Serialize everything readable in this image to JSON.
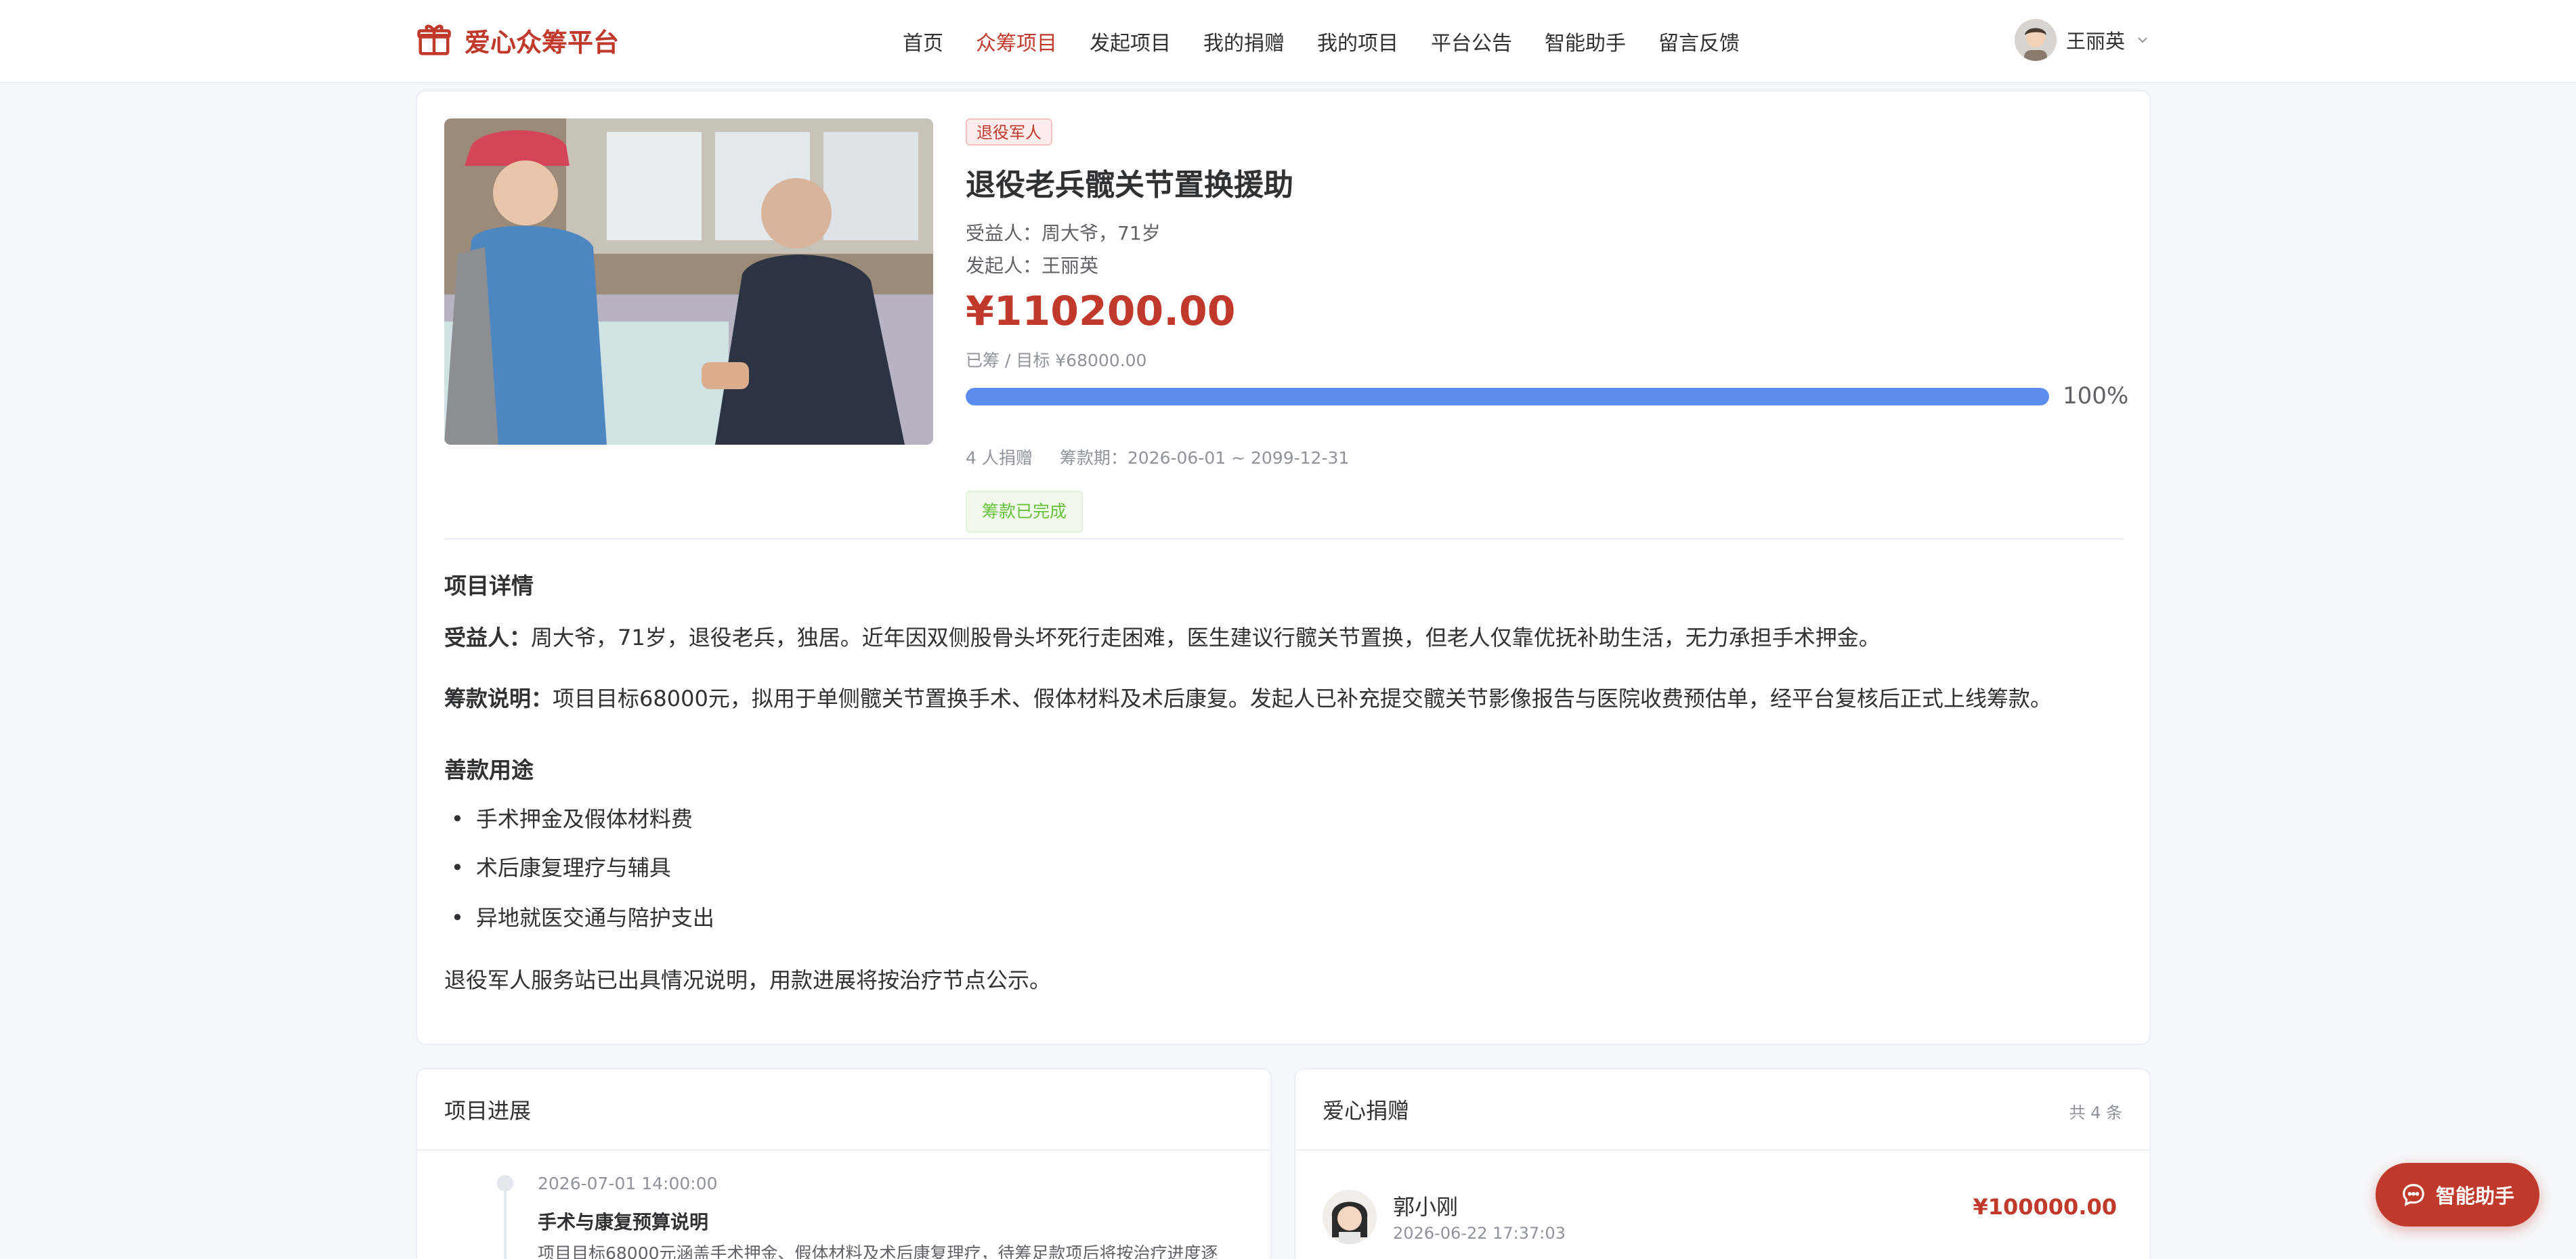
{
  "brand": {
    "name": "爱心众筹平台"
  },
  "nav": {
    "items": [
      "首页",
      "众筹项目",
      "发起项目",
      "我的捐赠",
      "我的项目",
      "平台公告",
      "智能助手",
      "留言反馈"
    ],
    "active": "众筹项目"
  },
  "user": {
    "name": "王丽英"
  },
  "project": {
    "tag": "退役军人",
    "title": "退役老兵髋关节置换援助",
    "beneficiary": "受益人：周大爷，71岁",
    "initiator": "发起人：王丽英",
    "raised": "¥110200.00",
    "target": "已筹 / 目标 ¥68000.00",
    "progress_percent": 100,
    "progress_text": "100%",
    "donor_count": "4 人捐赠",
    "period": "筹款期：2026-06-01 ~ 2099-12-31",
    "status": "筹款已完成"
  },
  "detail": {
    "section_title": "项目详情",
    "beneficiary_label": "受益人：",
    "beneficiary_text": "周大爷，71岁，退役老兵，独居。近年因双侧股骨头坏死行走困难，医生建议行髋关节置换，但老人仅靠优抚补助生活，无力承担手术押金。",
    "fund_label": "筹款说明：",
    "fund_text": "项目目标68000元，拟用于单侧髋关节置换手术、假体材料及术后康复。发起人已补充提交髋关节影像报告与医院收费预估单，经平台复核后正式上线筹款。",
    "usage_title": "善款用途",
    "usage_items": [
      "手术押金及假体材料费",
      "术后康复理疗与辅具",
      "异地就医交通与陪护支出"
    ],
    "note": "退役军人服务站已出具情况说明，用款进展将按治疗节点公示。"
  },
  "progress_card": {
    "title": "项目进展",
    "entry": {
      "time": "2026-07-01 14:00:00",
      "title": "手术与康复预算说明",
      "desc": "项目目标68000元涵盖手术押金、假体材料及术后康复理疗，待筹足款项后将按治疗进度逐"
    }
  },
  "donate_card": {
    "title": "爱心捐赠",
    "count": "共 4 条",
    "donor": {
      "name": "郭小刚",
      "date": "2026-06-22 17:37:03",
      "amount": "¥100000.00"
    }
  },
  "fab": {
    "label": "智能助手"
  },
  "colors": {
    "primary": "#c0392b",
    "progress": "#5b8def",
    "success": "#67c23a"
  }
}
